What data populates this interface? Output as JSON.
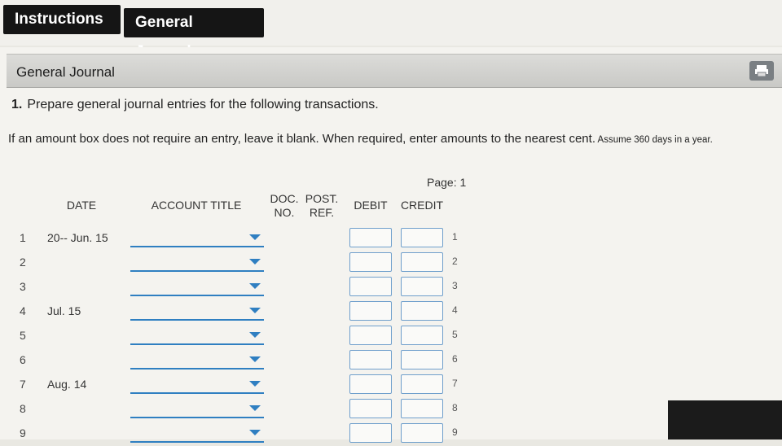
{
  "tabs": [
    {
      "label": "Instructions"
    },
    {
      "label": "General Journal"
    }
  ],
  "panel": {
    "title": "General Journal"
  },
  "question": {
    "number": "1.",
    "text": "Prepare general journal entries for the following transactions."
  },
  "note": {
    "main": "If an amount box does not require an entry, leave it blank. When required, enter amounts to the nearest cent.",
    "small": " Assume 360 days in a year."
  },
  "page_label": "Page: 1",
  "columns": {
    "date": "DATE",
    "account": "ACCOUNT TITLE",
    "doc_no": "DOC.\nNO.",
    "post_ref": "POST.\nREF.",
    "debit": "DEBIT",
    "credit": "CREDIT"
  },
  "rows": [
    {
      "num": "1",
      "date": "20-- Jun. 15",
      "line": "1"
    },
    {
      "num": "2",
      "date": "",
      "line": "2"
    },
    {
      "num": "3",
      "date": "",
      "line": "3"
    },
    {
      "num": "4",
      "date": "Jul. 15",
      "line": "4"
    },
    {
      "num": "5",
      "date": "",
      "line": "5"
    },
    {
      "num": "6",
      "date": "",
      "line": "6"
    },
    {
      "num": "7",
      "date": "Aug. 14",
      "line": "7"
    },
    {
      "num": "8",
      "date": "",
      "line": "8"
    },
    {
      "num": "9",
      "date": "",
      "line": "9"
    }
  ],
  "colors": {
    "accent": "#2f7fc1",
    "tab_bg": "#151515"
  }
}
